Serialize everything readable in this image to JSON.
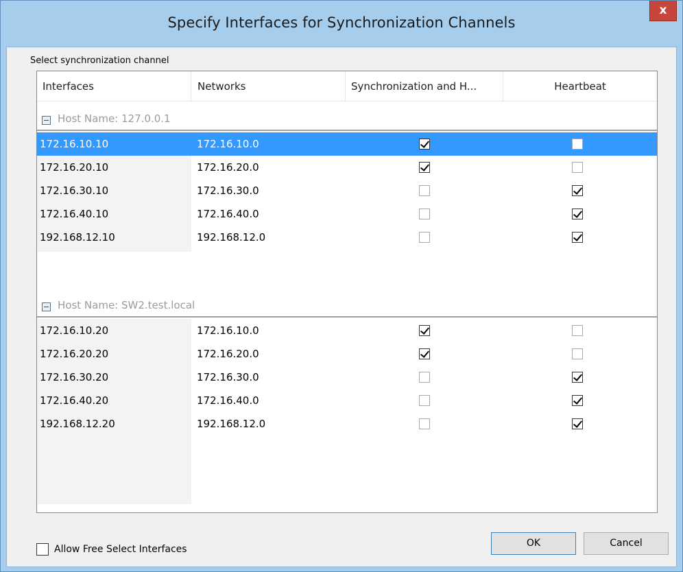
{
  "window": {
    "title": "Specify Interfaces for Synchronization Channels",
    "close_label": "x"
  },
  "section_label": "Select synchronization channel",
  "columns": {
    "interfaces": "Interfaces",
    "networks": "Networks",
    "sync": "Synchronization and H...",
    "heartbeat": "Heartbeat"
  },
  "groups": [
    {
      "title": "Host Name: 127.0.0.1",
      "rows": [
        {
          "interface": "172.16.10.10",
          "network": "172.16.10.0",
          "sync": true,
          "heartbeat": false,
          "selected": true
        },
        {
          "interface": "172.16.20.10",
          "network": "172.16.20.0",
          "sync": true,
          "heartbeat": false,
          "selected": false
        },
        {
          "interface": "172.16.30.10",
          "network": "172.16.30.0",
          "sync": false,
          "heartbeat": true,
          "selected": false
        },
        {
          "interface": "172.16.40.10",
          "network": "172.16.40.0",
          "sync": false,
          "heartbeat": true,
          "selected": false
        },
        {
          "interface": "192.168.12.10",
          "network": "192.168.12.0",
          "sync": false,
          "heartbeat": true,
          "selected": false
        }
      ]
    },
    {
      "title": "Host Name: SW2.test.local",
      "rows": [
        {
          "interface": "172.16.10.20",
          "network": "172.16.10.0",
          "sync": true,
          "heartbeat": false,
          "selected": false
        },
        {
          "interface": "172.16.20.20",
          "network": "172.16.20.0",
          "sync": true,
          "heartbeat": false,
          "selected": false
        },
        {
          "interface": "172.16.30.20",
          "network": "172.16.30.0",
          "sync": false,
          "heartbeat": true,
          "selected": false
        },
        {
          "interface": "172.16.40.20",
          "network": "172.16.40.0",
          "sync": false,
          "heartbeat": true,
          "selected": false
        },
        {
          "interface": "192.168.12.20",
          "network": "192.168.12.0",
          "sync": false,
          "heartbeat": true,
          "selected": false
        }
      ]
    }
  ],
  "footer": {
    "free_select_label": "Allow Free Select Interfaces",
    "free_select_checked": false,
    "ok_label": "OK",
    "cancel_label": "Cancel"
  }
}
